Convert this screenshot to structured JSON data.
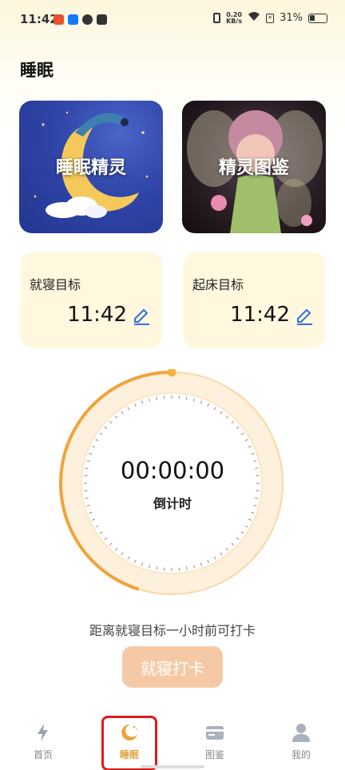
{
  "status_bar": {
    "time": "11:42",
    "net_speed_value": "0.20",
    "net_speed_unit": "KB/s",
    "battery": "31%"
  },
  "page": {
    "title": "睡眠"
  },
  "cards": {
    "sprite": {
      "label": "睡眠精灵"
    },
    "atlas": {
      "label": "精灵图鉴"
    }
  },
  "goals": {
    "bedtime": {
      "label": "就寝目标",
      "time": "11:42"
    },
    "wake": {
      "label": "起床目标",
      "time": "11:42"
    }
  },
  "timer": {
    "value": "00:00:00",
    "label": "倒计时",
    "progress": 0.45
  },
  "hint": "距离就寝目标一小时前可打卡",
  "checkin_button": "就寝打卡",
  "nav": {
    "items": [
      {
        "label": "首页",
        "icon": "lightning-icon"
      },
      {
        "label": "睡眠",
        "icon": "moon-icon",
        "active": true
      },
      {
        "label": "图鉴",
        "icon": "card-icon"
      },
      {
        "label": "我的",
        "icon": "person-icon"
      }
    ]
  },
  "colors": {
    "accent": "#f0a33a",
    "track": "#fdf0dc",
    "edit_blue": "#2f6fe0",
    "button": "#f6c9a6",
    "highlight": "#e01a1a"
  }
}
